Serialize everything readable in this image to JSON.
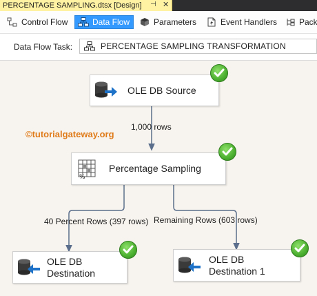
{
  "document_tab": {
    "title": "PERCENTAGE SAMPLING.dtsx [Design]",
    "pin_glyph": "⊣",
    "close_glyph": "✕"
  },
  "designer_tabs": [
    {
      "label": "Control Flow",
      "icon": "control-flow-icon",
      "active": false
    },
    {
      "label": "Data Flow",
      "icon": "data-flow-icon",
      "active": true
    },
    {
      "label": "Parameters",
      "icon": "parameters-icon",
      "active": false
    },
    {
      "label": "Event Handlers",
      "icon": "event-handlers-icon",
      "active": false
    },
    {
      "label": "Pack",
      "icon": "package-explorer-icon",
      "active": false
    }
  ],
  "task_row": {
    "label": "Data Flow Task:",
    "selected": "PERCENTAGE SAMPLING TRANSFORMATION"
  },
  "watermark": "©tutorialgateway.org",
  "components": {
    "source": {
      "label": "OLE DB Source",
      "icon": "ole-db-source-icon",
      "status": "success"
    },
    "sampling": {
      "label": "Percentage Sampling",
      "icon": "percentage-sampling-icon",
      "status": "success"
    },
    "destination": {
      "label_line1": "OLE DB",
      "label_line2": "Destination",
      "icon": "ole-db-destination-icon",
      "status": "success"
    },
    "destination1": {
      "label_line1": "OLE DB",
      "label_line2": "Destination 1",
      "icon": "ole-db-destination-icon",
      "status": "success"
    }
  },
  "paths": {
    "source_to_sampling": "1,000 rows",
    "sampling_to_destination": "40 Percent Rows (397 rows)",
    "sampling_to_destination1": "Remaining Rows (603 rows)"
  },
  "colors": {
    "active_tab": "#3399ff",
    "canvas": "#f7f3ee",
    "path_line": "#5b6f8c",
    "success": "#4cb030",
    "watermark": "#e07b1a",
    "document_tab": "#fff2a3"
  }
}
